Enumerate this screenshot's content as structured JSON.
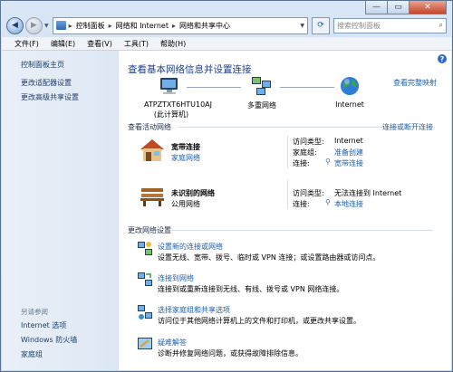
{
  "window": {
    "min_label": "—",
    "max_label": "▭",
    "close_label": "✕"
  },
  "address": {
    "back": "◀",
    "forward": "▶",
    "crumbs": [
      "控制面板",
      "网络和 Internet",
      "网络和共享中心"
    ],
    "separator": "▸",
    "search_placeholder": "搜索控制面板"
  },
  "menu": [
    "文件(F)",
    "编辑(E)",
    "查看(V)",
    "工具(T)",
    "帮助(H)"
  ],
  "sidebar": {
    "home": "控制面板主页",
    "items": [
      "更改适配器设置",
      "更改高级共享设置"
    ],
    "see_also_title": "另请参阅",
    "see_also": [
      "Internet 选项",
      "Windows 防火墙",
      "家庭组"
    ]
  },
  "main": {
    "title": "查看基本网络信息并设置连接",
    "view_full_map": "查看完整映射",
    "map": {
      "computer_name": "ATPZTXT6HTU10AJ",
      "computer_sub": "(此计算机)",
      "multi_network": "多重网络",
      "internet": "Internet"
    },
    "active_header": "查看活动网络",
    "connect_disconnect": "连接或断开连接",
    "networks": [
      {
        "name": "宽带连接",
        "type": "家庭网络",
        "access_label": "访问类型:",
        "access_value": "Internet",
        "homegroup_label": "家庭组:",
        "homegroup_value": "准备创建",
        "conn_label": "连接:",
        "conn_value": "宽带连接"
      },
      {
        "name": "未识别的网络",
        "type": "公用网络",
        "access_label": "访问类型:",
        "access_value": "无法连接到 Internet",
        "conn_label": "连接:",
        "conn_value": "本地连接"
      }
    ],
    "change_header": "更改网络设置",
    "tasks": [
      {
        "title": "设置新的连接或网络",
        "desc": "设置无线、宽带、拨号、临时或 VPN 连接；或设置路由器或访问点。"
      },
      {
        "title": "连接到网络",
        "desc": "连接到或重新连接到无线、有线、拨号或 VPN 网络连接。"
      },
      {
        "title": "选择家庭组和共享选项",
        "desc": "访问位于其他网络计算机上的文件和打印机，或更改共享设置。"
      },
      {
        "title": "疑难解答",
        "desc": "诊断并修复网络问题，或获得故障排除信息。"
      }
    ]
  }
}
